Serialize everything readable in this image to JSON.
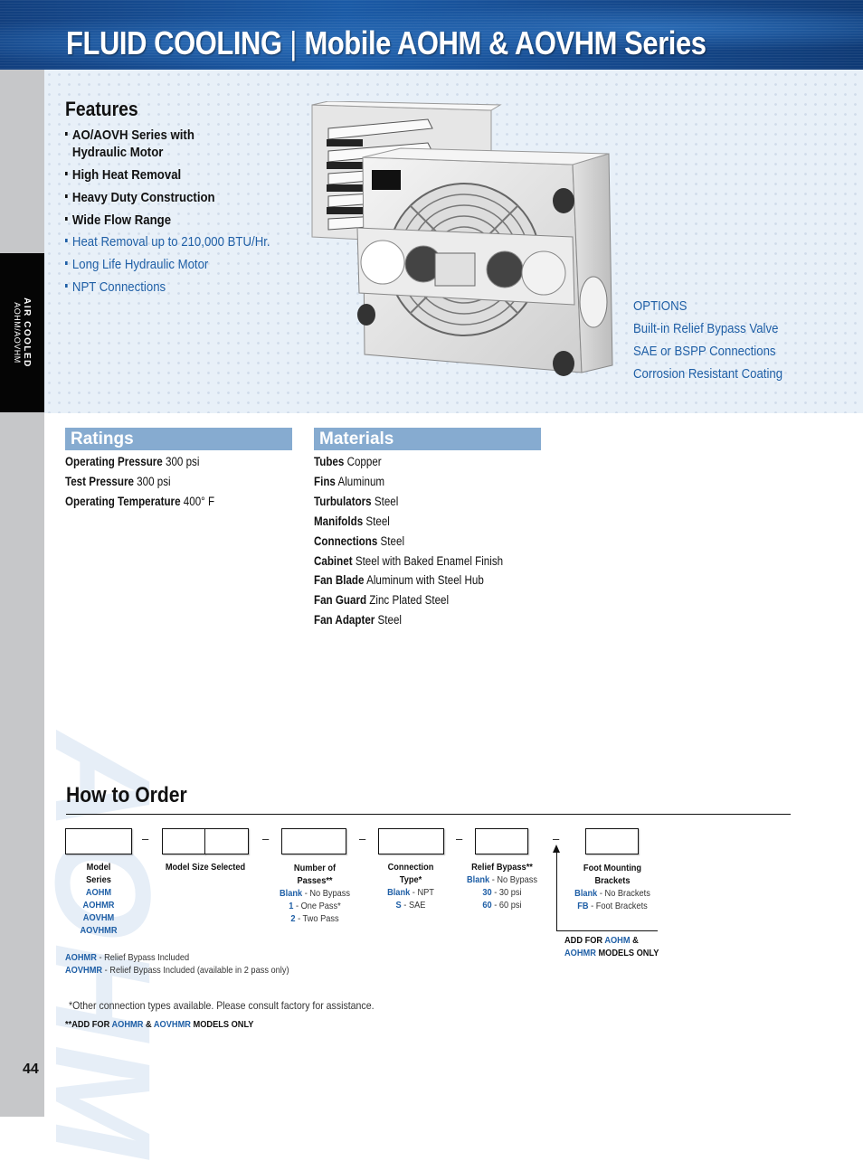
{
  "header": {
    "title_left": "FLUID COOLING",
    "separator": "|",
    "title_right": "Mobile AOHM & AOVHM Series"
  },
  "side_tab": {
    "line1": "AIR COOLED",
    "line2": "AOHM/AOVHM"
  },
  "features": {
    "title": "Features",
    "items_primary": [
      {
        "line1": "AO/AOVH Series with",
        "line2": "Hydraulic Motor"
      },
      {
        "line1": "High Heat Removal"
      },
      {
        "line1": "Heavy Duty Construction"
      },
      {
        "line1": "Wide Flow Range"
      }
    ],
    "items_secondary": [
      "Heat Removal up to 210,000 BTU/Hr.",
      "Long Life Hydraulic Motor",
      "NPT Connections"
    ]
  },
  "options": {
    "title": "OPTIONS",
    "items": [
      "Built-in Relief Bypass Valve",
      "SAE or BSPP Connections",
      "Corrosion Resistant Coating"
    ]
  },
  "product_image": {
    "alt": "AOHM mobile air cooled heat exchanger with hydraulic motor fan"
  },
  "ratings": {
    "title": "Ratings",
    "rows": [
      {
        "label": "Operating Pressure",
        "value": "300 psi"
      },
      {
        "label": "Test Pressure",
        "value": "300 psi"
      },
      {
        "label": "Operating Temperature",
        "value": "400° F"
      }
    ]
  },
  "materials": {
    "title": "Materials",
    "rows": [
      {
        "label": "Tubes",
        "value": "Copper"
      },
      {
        "label": "Fins",
        "value": "Aluminum"
      },
      {
        "label": "Turbulators",
        "value": "Steel"
      },
      {
        "label": "Manifolds",
        "value": "Steel"
      },
      {
        "label": "Connections",
        "value": "Steel"
      },
      {
        "label": "Cabinet",
        "value": "Steel with Baked Enamel Finish"
      },
      {
        "label": "Fan Blade",
        "value": "Aluminum with Steel Hub"
      },
      {
        "label": "Fan Guard",
        "value": "Zinc Plated Steel"
      },
      {
        "label": "Fan Adapter",
        "value": "Steel"
      }
    ]
  },
  "watermark": "AOHM",
  "how_to_order": {
    "title": "How to Order",
    "dash": "–",
    "columns": [
      {
        "label1": "Model",
        "label2": "Series",
        "options": [
          {
            "key": "AOHM",
            "desc": ""
          },
          {
            "key": "AOHMR",
            "desc": ""
          },
          {
            "key": "AOVHM",
            "desc": ""
          },
          {
            "key": "AOVHMR",
            "desc": ""
          }
        ]
      },
      {
        "label1": "Model Size Selected",
        "label2": "",
        "options": []
      },
      {
        "label1": "Number of",
        "label2": "Passes**",
        "options": [
          {
            "key": "Blank",
            "desc": " - No Bypass"
          },
          {
            "key": "1",
            "desc": " - One Pass*"
          },
          {
            "key": "2",
            "desc": " - Two Pass"
          }
        ]
      },
      {
        "label1": "Connection",
        "label2": "Type*",
        "options": [
          {
            "key": "Blank",
            "desc": " - NPT"
          },
          {
            "key": "S",
            "desc": " - SAE"
          }
        ]
      },
      {
        "label1": "Relief Bypass**",
        "label2": "",
        "options": [
          {
            "key": "Blank",
            "desc": " - No Bypass"
          },
          {
            "key": "30",
            "desc": " - 30 psi"
          },
          {
            "key": "60",
            "desc": " - 60 psi"
          }
        ]
      },
      {
        "label1": "Foot Mounting",
        "label2": "Brackets",
        "options": [
          {
            "key": "Blank",
            "desc": " - No Brackets"
          },
          {
            "key": "FB",
            "desc": " - Foot Brackets"
          }
        ]
      }
    ],
    "foot_note": {
      "prefix": "ADD FOR ",
      "k1": "AOHM",
      "mid": " &",
      "k2": "AOHMR",
      "suffix": " MODELS ONLY"
    },
    "notes": [
      {
        "key": "AOHMR",
        "desc": " - Relief Bypass Included"
      },
      {
        "key": "AOVHMR",
        "desc": " - Relief Bypass Included (available in 2 pass only)"
      }
    ],
    "footnote1": "*Other connection types available. Please consult factory for assistance.",
    "footnote2": {
      "prefix": "**ADD FOR ",
      "k1": "AOHMR",
      "mid": " & ",
      "k2": "AOVHMR",
      "suffix": " MODELS ONLY"
    }
  },
  "page_number": "44"
}
